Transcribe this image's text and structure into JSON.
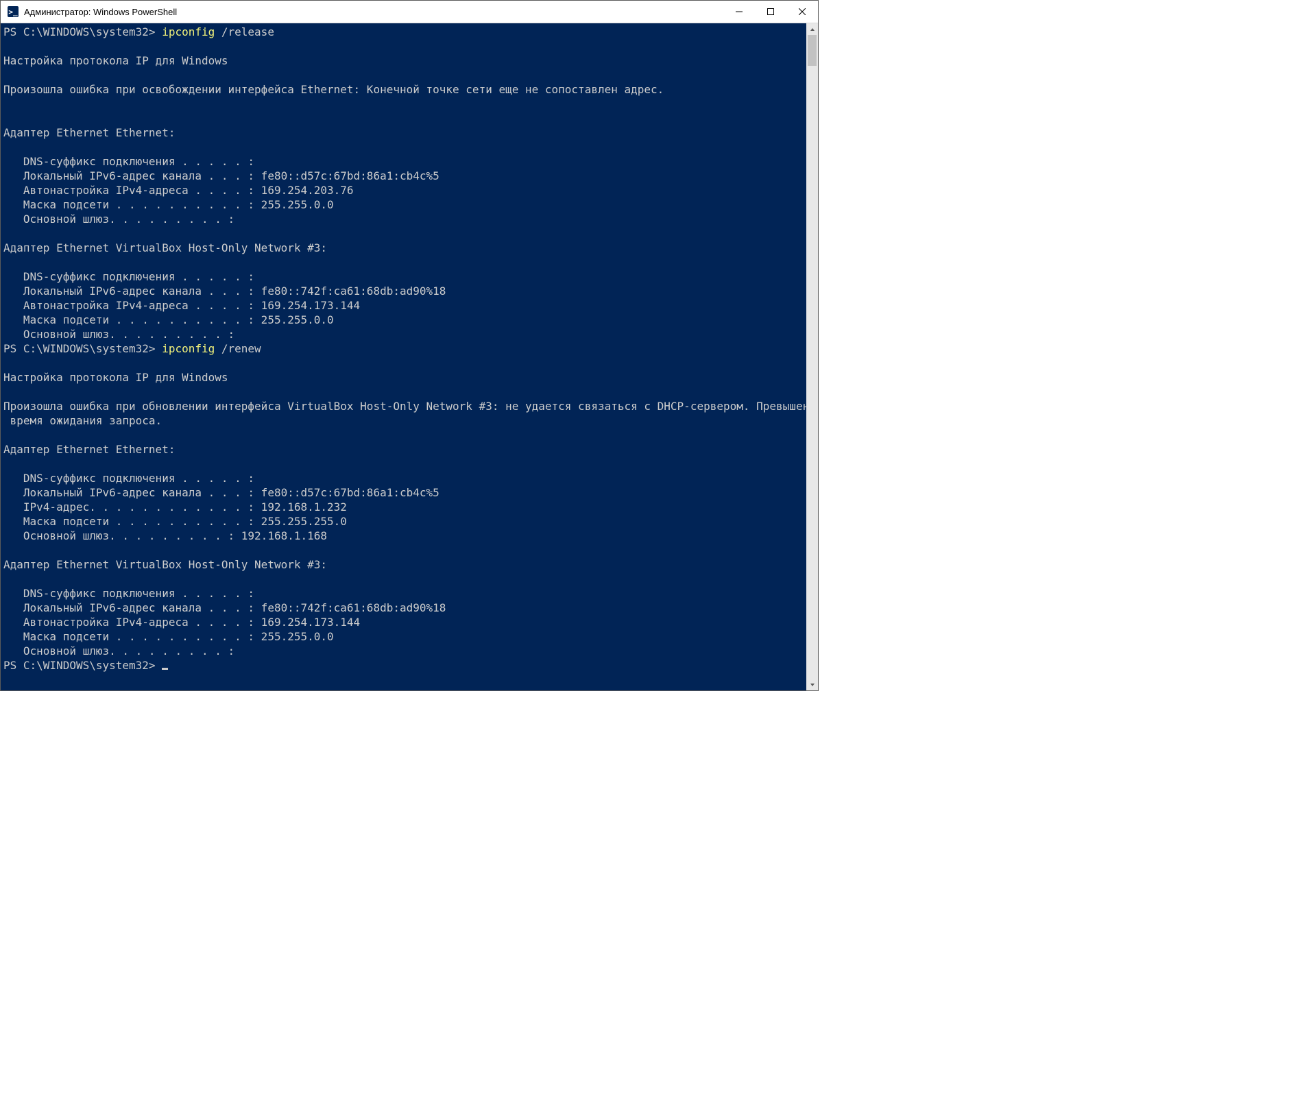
{
  "window": {
    "title": "Администратор: Windows PowerShell"
  },
  "session": {
    "prompt_text": "PS C:\\WINDOWS\\system32> ",
    "header": "Настройка протокола IP для Windows",
    "cmd_release": {
      "exe": "ipconfig",
      "args": " /release"
    },
    "cmd_renew": {
      "exe": "ipconfig",
      "args": " /renew"
    },
    "release_error": "Произошла ошибка при освобождении интерфейса Ethernet: Конечной точке сети еще не сопоставлен адрес.",
    "release_adapter1_title": "Адаптер Ethernet Ethernet:",
    "release_adapter1_dns": "   DNS-суффикс подключения . . . . . :",
    "release_adapter1_llv6": "   Локальный IPv6-адрес канала . . . : fe80::d57c:67bd:86a1:cb4c%5",
    "release_adapter1_autov4": "   Автонастройка IPv4-адреса . . . . : 169.254.203.76",
    "release_adapter1_mask": "   Маска подсети . . . . . . . . . . : 255.255.0.0",
    "release_adapter1_gw": "   Основной шлюз. . . . . . . . . :",
    "release_adapter2_title": "Адаптер Ethernet VirtualBox Host-Only Network #3:",
    "release_adapter2_dns": "   DNS-суффикс подключения . . . . . :",
    "release_adapter2_llv6": "   Локальный IPv6-адрес канала . . . : fe80::742f:ca61:68db:ad90%18",
    "release_adapter2_autov4": "   Автонастройка IPv4-адреса . . . . : 169.254.173.144",
    "release_adapter2_mask": "   Маска подсети . . . . . . . . . . : 255.255.0.0",
    "release_adapter2_gw": "   Основной шлюз. . . . . . . . . :",
    "renew_error_l1": "Произошла ошибка при обновлении интерфейса VirtualBox Host-Only Network #3: не удается связаться с DHCP-сервером. Превышено",
    "renew_error_l2": " время ожидания запроса.",
    "renew_adapter1_title": "Адаптер Ethernet Ethernet:",
    "renew_adapter1_dns": "   DNS-суффикс подключения . . . . . :",
    "renew_adapter1_llv6": "   Локальный IPv6-адрес канала . . . : fe80::d57c:67bd:86a1:cb4c%5",
    "renew_adapter1_ipv4": "   IPv4-адрес. . . . . . . . . . . . : 192.168.1.232",
    "renew_adapter1_mask": "   Маска подсети . . . . . . . . . . : 255.255.255.0",
    "renew_adapter1_gw": "   Основной шлюз. . . . . . . . . : 192.168.1.168",
    "renew_adapter2_title": "Адаптер Ethernet VirtualBox Host-Only Network #3:",
    "renew_adapter2_dns": "   DNS-суффикс подключения . . . . . :",
    "renew_adapter2_llv6": "   Локальный IPv6-адрес канала . . . : fe80::742f:ca61:68db:ad90%18",
    "renew_adapter2_autov4": "   Автонастройка IPv4-адреса . . . . : 169.254.173.144",
    "renew_adapter2_mask": "   Маска подсети . . . . . . . . . . : 255.255.0.0",
    "renew_adapter2_gw": "   Основной шлюз. . . . . . . . . :"
  },
  "colors": {
    "terminal_bg": "#012456",
    "text": "#cccccc",
    "command": "#f2f27a"
  }
}
